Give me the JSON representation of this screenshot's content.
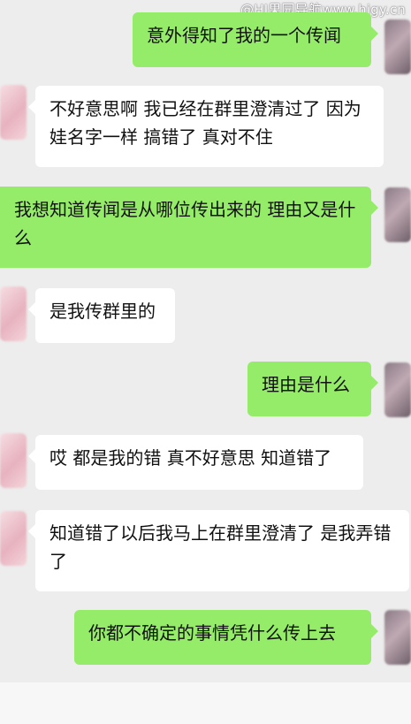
{
  "watermark": "@HI果园导航www.higy.cn",
  "messages": [
    {
      "side": "right",
      "text": "意外得知了我的一个传闻"
    },
    {
      "side": "left",
      "text": "不好意思啊 我已经在群里澄清过了 因为娃名字一样 搞错了 真对不住"
    },
    {
      "side": "right",
      "text": "我想知道传闻是从哪位传出来的 理由又是什么"
    },
    {
      "side": "left",
      "text": "是我传群里的"
    },
    {
      "side": "right",
      "text": "理由是什么"
    },
    {
      "side": "left",
      "text": "哎 都是我的错 真不好意思 知道错了"
    },
    {
      "side": "left",
      "text": "知道错了以后我马上在群里澄清了 是我弄错了"
    },
    {
      "side": "right",
      "text": "你都不确定的事情凭什么传上去"
    }
  ]
}
